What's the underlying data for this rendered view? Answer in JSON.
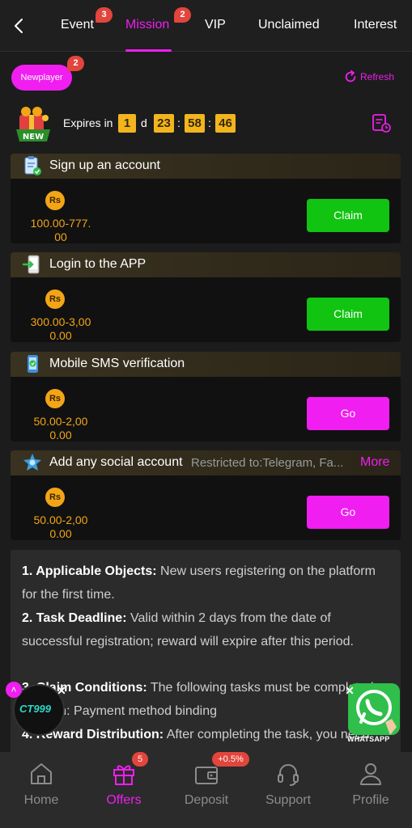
{
  "tabs": [
    {
      "label": "Event",
      "badge": "3"
    },
    {
      "label": "Mission",
      "badge": "2",
      "active": true
    },
    {
      "label": "VIP"
    },
    {
      "label": "Unclaimed"
    },
    {
      "label": "Interest"
    }
  ],
  "header": {
    "newplayer_label": "Newplayer",
    "newplayer_badge": "2",
    "refresh_label": "Refresh",
    "gift_badge": "NEW",
    "expires_label": "Expires in",
    "countdown": {
      "days": "1",
      "day_unit": "d",
      "hours": "23",
      "minutes": "58",
      "seconds": "46",
      "sep": ":"
    }
  },
  "tasks": [
    {
      "title": "Sign up an account",
      "currency": "Rs",
      "amount_line1": "100.00-777.",
      "amount_line2": "00",
      "button": "Claim"
    },
    {
      "title": "Login to the APP",
      "currency": "Rs",
      "amount_line1": "300.00-3,00",
      "amount_line2": "0.00",
      "button": "Claim"
    },
    {
      "title": "Mobile SMS verification",
      "currency": "Rs",
      "amount_line1": "50.00-2,00",
      "amount_line2": "0.00",
      "button": "Go"
    },
    {
      "title": "Add any social account",
      "restriction": "Restricted to:Telegram, Fa...",
      "more": "More",
      "currency": "Rs",
      "amount_line1": "50.00-2,00",
      "amount_line2": "0.00",
      "button": "Go"
    }
  ],
  "rules": {
    "r1_head": "1. Applicable Objects:",
    "r1_text": " New users registering on the platform for the first time.",
    "r2_head": "2. Task Deadline:",
    "r2_text": " Valid within 2 days from the date of successful registration; reward will expire after this period.",
    "r3_head": "3. Claim Conditions:",
    "r3_text": " The following tasks must be completed to claim: Payment method binding",
    "r4_head": "4. Reward Distribution:",
    "r4_text": " After completing the task, you need to manually claim it within the specified time limit."
  },
  "floating": {
    "ct_logo": "CT999",
    "whatsapp_label": "WHATSAPP"
  },
  "bottom_nav": [
    {
      "label": "Home"
    },
    {
      "label": "Offers",
      "badge": "5",
      "active": true
    },
    {
      "label": "Deposit",
      "badge": "+0.5%"
    },
    {
      "label": "Support"
    },
    {
      "label": "Profile"
    }
  ],
  "colors": {
    "accent": "#f01ef0",
    "claim": "#11c411",
    "gold": "#f2a516",
    "badge": "#e2453c"
  }
}
